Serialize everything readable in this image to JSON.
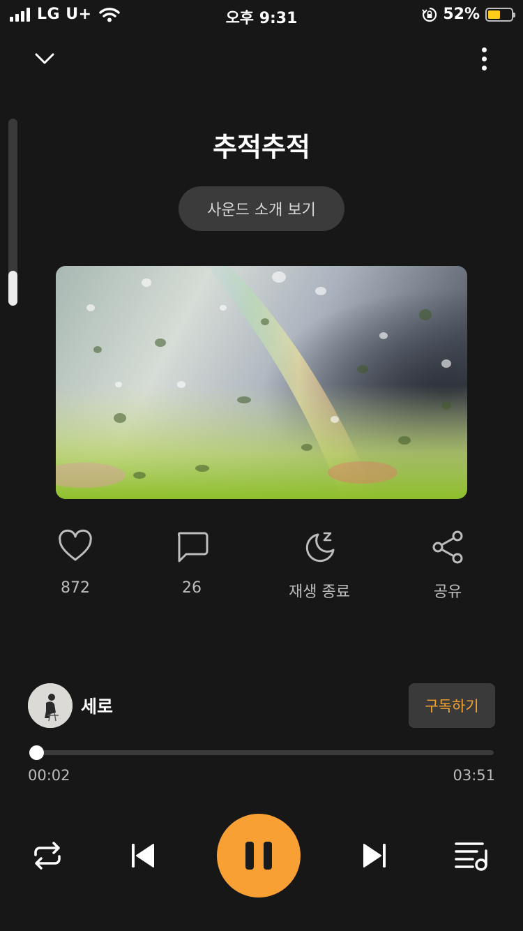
{
  "status_bar": {
    "carrier": "LG U+",
    "time": "오후 9:31",
    "battery_percent": "52%",
    "battery_level": 0.52,
    "icons": [
      "signal-icon",
      "wifi-icon",
      "rotation-lock-icon",
      "battery-icon"
    ]
  },
  "header": {
    "collapse_icon": "chevron-down-icon",
    "more_icon": "more-vertical-icon"
  },
  "track": {
    "title": "추적추적",
    "intro_button_label": "사운드 소개 보기",
    "cover_art": "rain-on-window-rainbow-image"
  },
  "actions": [
    {
      "icon": "heart-icon",
      "label": "872"
    },
    {
      "icon": "comment-icon",
      "label": "26"
    },
    {
      "icon": "sleep-timer-icon",
      "label": "재생 종료"
    },
    {
      "icon": "share-icon",
      "label": "공유"
    }
  ],
  "artist": {
    "name": "세로",
    "subscribe_label": "구독하기"
  },
  "player": {
    "current_time": "00:02",
    "total_time": "03:51",
    "progress": 0.0087,
    "controls": [
      "repeat-icon",
      "previous-icon",
      "pause-icon",
      "next-icon",
      "playlist-icon"
    ]
  },
  "colors": {
    "background": "#171717",
    "accent": "#f9a035",
    "subscribe_text": "#f5a22e",
    "battery": "#ffcc1a"
  }
}
